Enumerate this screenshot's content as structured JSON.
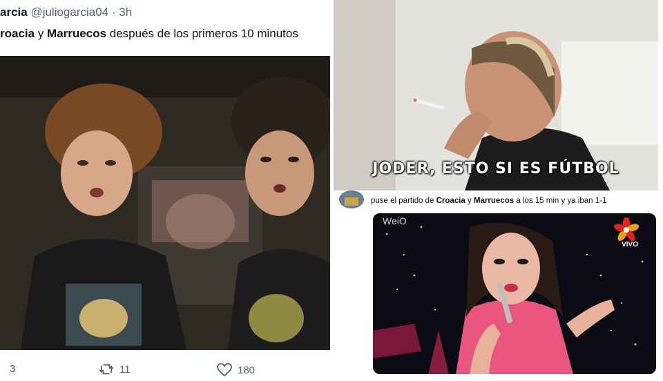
{
  "left_tweet": {
    "author_name": "arcia",
    "handle": "@juliogarcia04",
    "separator": "·",
    "time": "3h",
    "text_part1": "roacia",
    "text_part2": " y ",
    "text_part3": "Marruecos",
    "text_part4": " después de los primeros 10 minutos",
    "reply_count": "3",
    "retweet_count": "11",
    "like_count": "180"
  },
  "top_meme": {
    "caption": "JODER, ESTO SI ES FÚTBOL"
  },
  "right_tweet": {
    "text_part1": "puse el partido de ",
    "text_part2": "Croacia",
    "text_part3": " y ",
    "text_part4": "Marruecos",
    "text_part5": " a los 15 min y ya iban 1-1",
    "watermark": "WeiO",
    "channel_label": "VIVO"
  },
  "icons": {
    "retweet": "retweet-icon",
    "like": "heart-icon",
    "channel": "flower-logo-icon"
  },
  "colors": {
    "text": "#0f1419",
    "secondary": "#536471",
    "logo_red": "#e2231a"
  }
}
